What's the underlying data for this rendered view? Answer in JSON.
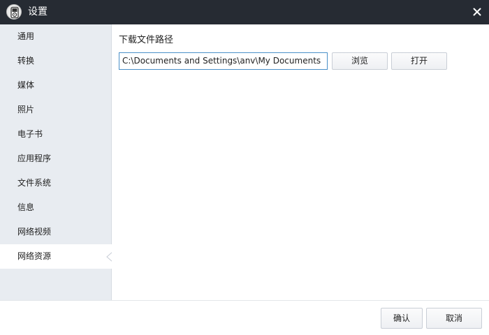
{
  "window": {
    "title": "设置",
    "app_icon": "ipod-icon",
    "close_icon": "close-icon"
  },
  "sidebar": {
    "items": [
      {
        "label": "通用"
      },
      {
        "label": "转换"
      },
      {
        "label": "媒体"
      },
      {
        "label": "照片"
      },
      {
        "label": "电子书"
      },
      {
        "label": "应用程序"
      },
      {
        "label": "文件系统"
      },
      {
        "label": "信息"
      },
      {
        "label": "网络视频"
      },
      {
        "label": "网络资源",
        "active": true
      }
    ]
  },
  "main": {
    "section_title": "下载文件路径",
    "path_value": "C:\\Documents and Settings\\anv\\My Documents",
    "browse_label": "浏览",
    "open_label": "打开"
  },
  "footer": {
    "ok_label": "确认",
    "cancel_label": "取消"
  },
  "colors": {
    "titlebar": "#262b33",
    "sidebar": "#e8ecf1",
    "input_border": "#4a90c8"
  }
}
